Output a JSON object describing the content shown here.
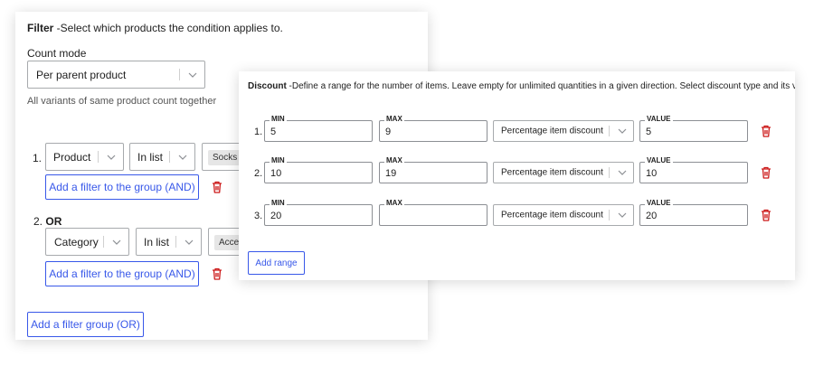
{
  "filter": {
    "title": "Filter",
    "description": " -Select which products the condition applies to.",
    "count_mode_label": "Count mode",
    "count_mode_value": "Per parent product",
    "count_mode_help": "All variants of same product count together",
    "groups": [
      {
        "number": "1.",
        "field": "Product",
        "operator": "In list",
        "tag": "Socks",
        "add_filter_label": "Add a filter to the group (AND)"
      },
      {
        "number": "2.",
        "or_label": "OR",
        "field": "Category",
        "operator": "In list",
        "tag": "Acce",
        "add_filter_label": "Add a filter to the group (AND)"
      }
    ],
    "add_group_label": "Add a filter group (OR)"
  },
  "discount": {
    "title": "Discount",
    "description": " -Define a range for the number of items. Leave empty for unlimited quantities in a given direction. Select discount type and its v",
    "min_label": "MIN",
    "max_label": "MAX",
    "value_label": "VALUE",
    "rows": [
      {
        "number": "1.",
        "min": "5",
        "max": "9",
        "type": "Percentage item discount",
        "value": "5"
      },
      {
        "number": "2.",
        "min": "10",
        "max": "19",
        "type": "Percentage item discount",
        "value": "10"
      },
      {
        "number": "3.",
        "min": "20",
        "max": "",
        "type": "Percentage item discount",
        "value": "20"
      }
    ],
    "add_range_label": "Add range"
  },
  "colors": {
    "accent": "#3858e9",
    "danger": "#cc1818",
    "border": "#8c8f94"
  }
}
